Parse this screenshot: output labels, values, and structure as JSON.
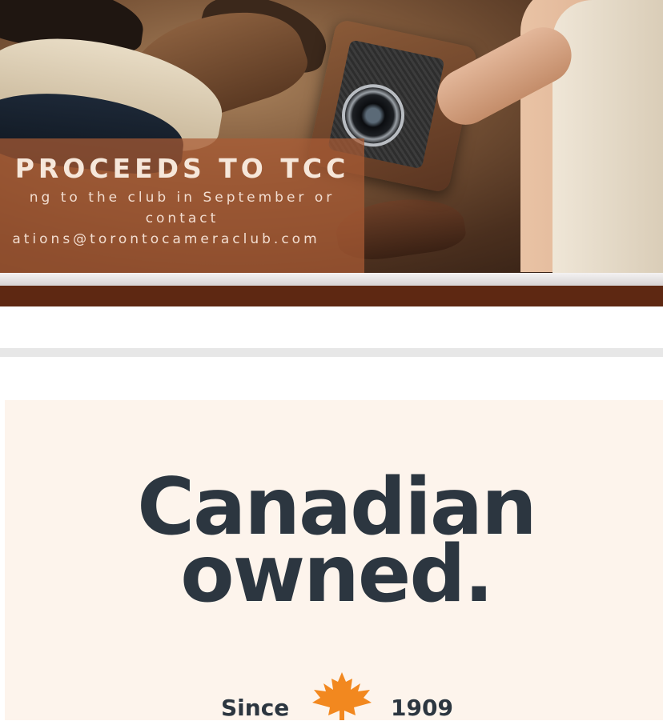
{
  "banner": {
    "heading": "PROCEEDS TO TCC",
    "line1": "ng to the club in September or",
    "line2": "contact",
    "line3": "ations@torontocameraclub.com"
  },
  "card": {
    "title_line1": "Canadian",
    "title_line2": "owned.",
    "since_label": "Since",
    "since_year": "1909",
    "icon": "maple-leaf-icon"
  },
  "colors": {
    "banner_overlay": "#aa5c34",
    "brown_stripe": "#5e2812",
    "card_background": "#fdf4ec",
    "title_text": "#2c3640",
    "maple_leaf": "#f2881f"
  }
}
